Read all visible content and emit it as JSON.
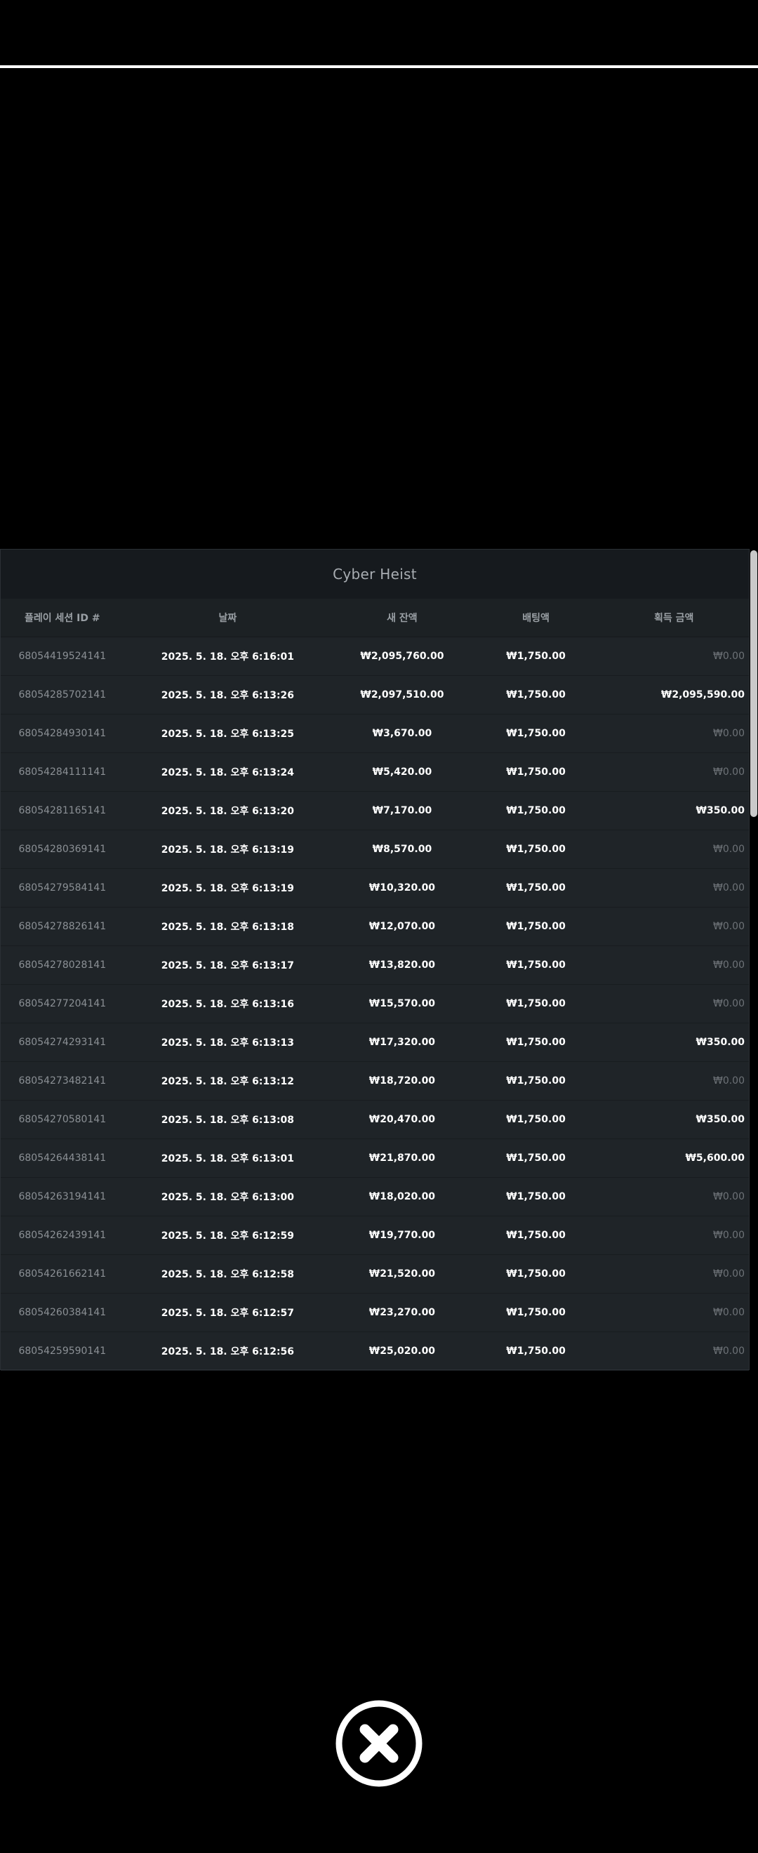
{
  "panel": {
    "title": "Cyber Heist",
    "headers": [
      "플레이 세션 ID #",
      "날짜",
      "새 잔액",
      "배팅액",
      "획득 금액"
    ]
  },
  "rows": [
    {
      "id": "68054419524141",
      "date": "2025. 5. 18. 오후 6:16:01",
      "balance": "₩2,095,760.00",
      "bet": "₩1,750.00",
      "win": "₩0.00"
    },
    {
      "id": "68054285702141",
      "date": "2025. 5. 18. 오후 6:13:26",
      "balance": "₩2,097,510.00",
      "bet": "₩1,750.00",
      "win": "₩2,095,590.00"
    },
    {
      "id": "68054284930141",
      "date": "2025. 5. 18. 오후 6:13:25",
      "balance": "₩3,670.00",
      "bet": "₩1,750.00",
      "win": "₩0.00"
    },
    {
      "id": "68054284111141",
      "date": "2025. 5. 18. 오후 6:13:24",
      "balance": "₩5,420.00",
      "bet": "₩1,750.00",
      "win": "₩0.00"
    },
    {
      "id": "68054281165141",
      "date": "2025. 5. 18. 오후 6:13:20",
      "balance": "₩7,170.00",
      "bet": "₩1,750.00",
      "win": "₩350.00"
    },
    {
      "id": "68054280369141",
      "date": "2025. 5. 18. 오후 6:13:19",
      "balance": "₩8,570.00",
      "bet": "₩1,750.00",
      "win": "₩0.00"
    },
    {
      "id": "68054279584141",
      "date": "2025. 5. 18. 오후 6:13:19",
      "balance": "₩10,320.00",
      "bet": "₩1,750.00",
      "win": "₩0.00"
    },
    {
      "id": "68054278826141",
      "date": "2025. 5. 18. 오후 6:13:18",
      "balance": "₩12,070.00",
      "bet": "₩1,750.00",
      "win": "₩0.00"
    },
    {
      "id": "68054278028141",
      "date": "2025. 5. 18. 오후 6:13:17",
      "balance": "₩13,820.00",
      "bet": "₩1,750.00",
      "win": "₩0.00"
    },
    {
      "id": "68054277204141",
      "date": "2025. 5. 18. 오후 6:13:16",
      "balance": "₩15,570.00",
      "bet": "₩1,750.00",
      "win": "₩0.00"
    },
    {
      "id": "68054274293141",
      "date": "2025. 5. 18. 오후 6:13:13",
      "balance": "₩17,320.00",
      "bet": "₩1,750.00",
      "win": "₩350.00"
    },
    {
      "id": "68054273482141",
      "date": "2025. 5. 18. 오후 6:13:12",
      "balance": "₩18,720.00",
      "bet": "₩1,750.00",
      "win": "₩0.00"
    },
    {
      "id": "68054270580141",
      "date": "2025. 5. 18. 오후 6:13:08",
      "balance": "₩20,470.00",
      "bet": "₩1,750.00",
      "win": "₩350.00"
    },
    {
      "id": "68054264438141",
      "date": "2025. 5. 18. 오후 6:13:01",
      "balance": "₩21,870.00",
      "bet": "₩1,750.00",
      "win": "₩5,600.00"
    },
    {
      "id": "68054263194141",
      "date": "2025. 5. 18. 오후 6:13:00",
      "balance": "₩18,020.00",
      "bet": "₩1,750.00",
      "win": "₩0.00"
    },
    {
      "id": "68054262439141",
      "date": "2025. 5. 18. 오후 6:12:59",
      "balance": "₩19,770.00",
      "bet": "₩1,750.00",
      "win": "₩0.00"
    },
    {
      "id": "68054261662141",
      "date": "2025. 5. 18. 오후 6:12:58",
      "balance": "₩21,520.00",
      "bet": "₩1,750.00",
      "win": "₩0.00"
    },
    {
      "id": "68054260384141",
      "date": "2025. 5. 18. 오후 6:12:57",
      "balance": "₩23,270.00",
      "bet": "₩1,750.00",
      "win": "₩0.00"
    },
    {
      "id": "68054259590141",
      "date": "2025. 5. 18. 오후 6:12:56",
      "balance": "₩25,020.00",
      "bet": "₩1,750.00",
      "win": "₩0.00"
    }
  ],
  "icons": {
    "close": "close-x-icon"
  },
  "colors": {
    "background": "#000000",
    "panel": "#1f2428",
    "title_bar": "#161a1e",
    "zero_win": "#6d7277"
  }
}
